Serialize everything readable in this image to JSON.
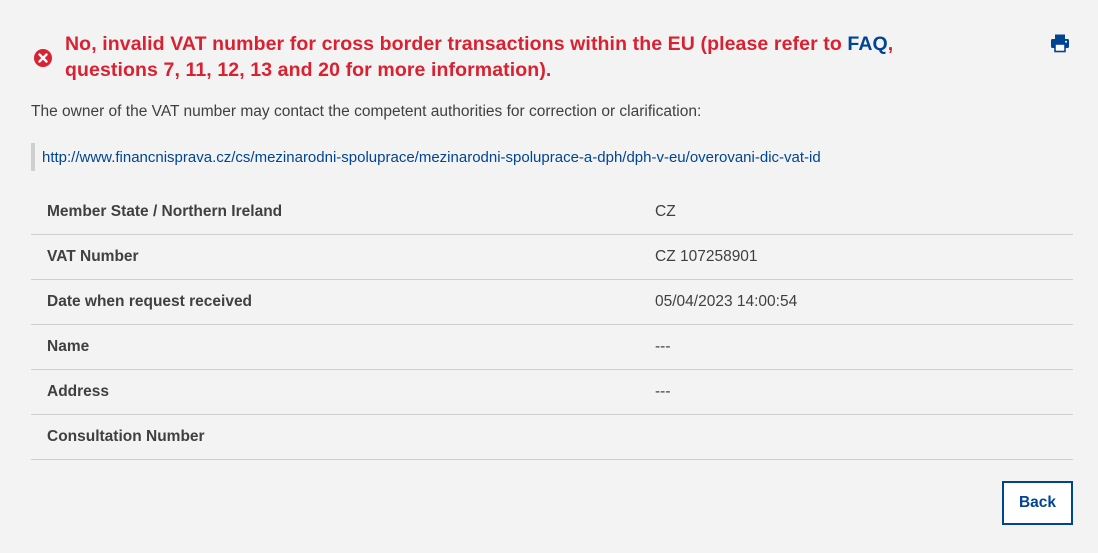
{
  "alert": {
    "message_before_link": "No, invalid VAT number for cross border transactions within the EU (please refer to ",
    "faq_link": "FAQ",
    "message_after_link": ",",
    "message_line2": "questions 7, 11, 12, 13 and 20 for more information).",
    "icon": "error-circle-icon",
    "color": "#da2131"
  },
  "print": {
    "icon": "printer-icon"
  },
  "owner_notice": "The owner of the VAT number may contact the competent authorities for correction or clarification:",
  "authority_url": "http://www.financnisprava.cz/cs/mezinarodni-spoluprace/mezinarodni-spoluprace-a-dph/dph-v-eu/overovani-dic-vat-id",
  "details": {
    "rows": [
      {
        "label": "Member State / Northern Ireland",
        "value": "CZ"
      },
      {
        "label": "VAT Number",
        "value": "CZ 107258901"
      },
      {
        "label": "Date when request received",
        "value": "05/04/2023 14:00:54"
      },
      {
        "label": "Name",
        "value": "---"
      },
      {
        "label": "Address",
        "value": "---"
      },
      {
        "label": "Consultation Number",
        "value": ""
      }
    ]
  },
  "actions": {
    "back_label": "Back"
  },
  "colors": {
    "link": "#004494",
    "error": "#da2131",
    "background": "#f3f3f3"
  }
}
